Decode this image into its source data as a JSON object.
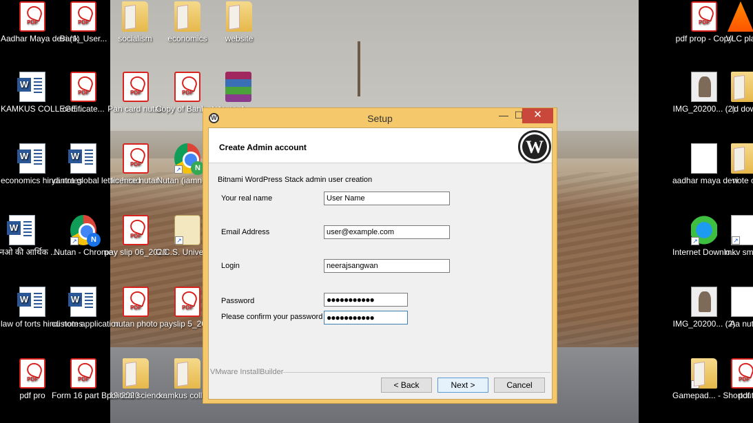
{
  "desktop": {
    "icons_left": [
      {
        "label": "Aadhar Maya devi (1)",
        "type": "pdf"
      },
      {
        "label": "Bank_User...",
        "type": "pdf"
      },
      {
        "label": "KAMKUS COLLEGE ...",
        "type": "word"
      },
      {
        "label": "certificate...",
        "type": "pdf"
      },
      {
        "label": "economics hindi notes",
        "type": "word"
      },
      {
        "label": "yantra global letter head",
        "type": "word"
      },
      {
        "label": "यूएनओ की आर्थिक ...",
        "type": "word"
      },
      {
        "label": "Nutan - Chrome",
        "type": "chrome"
      },
      {
        "label": "law of torts hindi notes",
        "type": "word"
      },
      {
        "label": "custom application",
        "type": "word"
      },
      {
        "label": "pdf pro",
        "type": "pdf"
      },
      {
        "label": "Form 16 part B 19-2020",
        "type": "pdf"
      }
    ],
    "icons_middle": [
      {
        "label": "socialism",
        "type": "folder"
      },
      {
        "label": "economics",
        "type": "folder"
      },
      {
        "label": "website",
        "type": "folder"
      },
      {
        "label": "Pan card nutan",
        "type": "pdf"
      },
      {
        "label": "Copy of Bank statement",
        "type": "pdf"
      },
      {
        "label": "licence nutan",
        "type": "pdf"
      },
      {
        "label": "Nutan (iamnutan",
        "type": "chrome"
      },
      {
        "label": "pay slip 06_2020",
        "type": "pdf"
      },
      {
        "label": "C.C.S. Universi...",
        "type": "seal"
      },
      {
        "label": "nutan photo",
        "type": "pdf"
      },
      {
        "label": "payslip 5_2020",
        "type": "pdf"
      },
      {
        "label": "political science",
        "type": "folder"
      },
      {
        "label": "kamkus collage",
        "type": "folder"
      }
    ],
    "icons_right": [
      {
        "label": "pdf prop - Copy",
        "type": "pdf"
      },
      {
        "label": "VLC pla",
        "type": "vlc"
      },
      {
        "label": "IMG_20200... (2)",
        "type": "photo"
      },
      {
        "label": "id dow",
        "type": "folder"
      },
      {
        "label": "aadhar maya devi",
        "type": "blank"
      },
      {
        "label": "note o",
        "type": "folder"
      },
      {
        "label": "Internet Downlo...",
        "type": "idm"
      },
      {
        "label": "mkv smart",
        "type": "film"
      },
      {
        "label": "IMG_20200... (2)",
        "type": "photo"
      },
      {
        "label": "Aa nuta",
        "type": "film"
      },
      {
        "label": "Gamepad... - Shortcut",
        "type": "folder"
      },
      {
        "label": "pdf",
        "type": "pdf"
      }
    ]
  },
  "dialog": {
    "title": "Setup",
    "header_title": "Create Admin account",
    "section_label": "Bitnami WordPress Stack admin user creation",
    "fields": {
      "real_name": {
        "label": "Your real name",
        "value": "User Name"
      },
      "email": {
        "label": "Email Address",
        "value": "user@example.com"
      },
      "login": {
        "label": "Login",
        "value": "neerajsangwan"
      },
      "password": {
        "label": "Password",
        "value": "●●●●●●●●●●●"
      },
      "confirm": {
        "label": "Please confirm your password",
        "value": "●●●●●●●●●●●"
      }
    },
    "branding": "VMware InstallBuilder",
    "buttons": {
      "back": "< Back",
      "next": "Next >",
      "cancel": "Cancel"
    },
    "controls": {
      "minimize": "—",
      "maximize": "☐",
      "close": "✕"
    },
    "logo_letter": "W",
    "pdf_badge": "PDF"
  }
}
